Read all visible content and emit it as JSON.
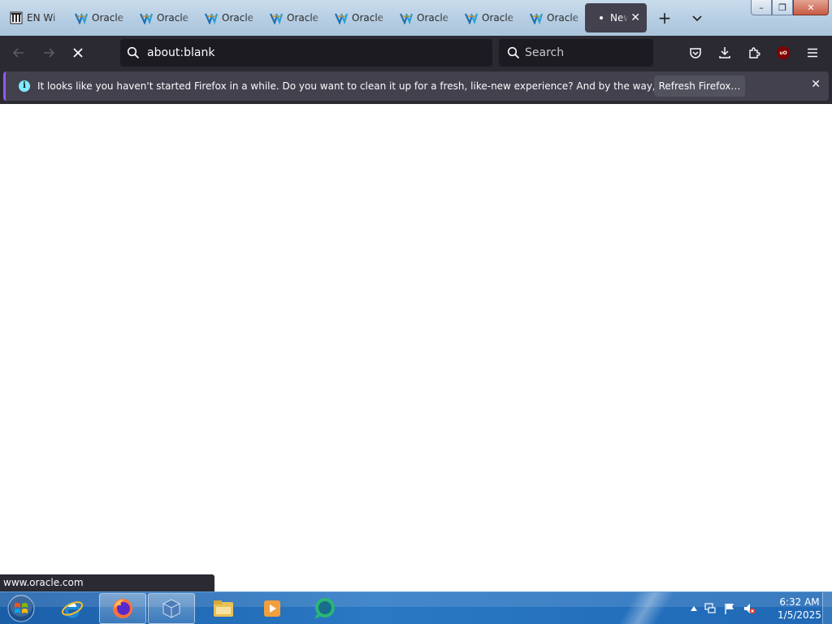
{
  "window": {
    "minimize_symbol": "–",
    "maximize_symbol": "❐",
    "close_symbol": "✕"
  },
  "tabs": [
    {
      "label": "EN Wi",
      "icon": "wikipedia-icon",
      "active": false
    },
    {
      "label": "Oracle",
      "icon": "oracle-icon",
      "active": false
    },
    {
      "label": "Oracle",
      "icon": "oracle-icon",
      "active": false
    },
    {
      "label": "Oracle",
      "icon": "oracle-icon",
      "active": false
    },
    {
      "label": "Oracle",
      "icon": "oracle-icon",
      "active": false
    },
    {
      "label": "Oracle",
      "icon": "oracle-icon",
      "active": false
    },
    {
      "label": "Oracle",
      "icon": "oracle-icon",
      "active": false
    },
    {
      "label": "Oracle",
      "icon": "oracle-icon",
      "active": false
    },
    {
      "label": "Oracle",
      "icon": "oracle-icon",
      "active": false
    },
    {
      "label": "New",
      "icon": "loading-dot-icon",
      "active": true,
      "close": "✕"
    }
  ],
  "tabstrip": {
    "new_tab": "+",
    "list_all_tabs": "⌄"
  },
  "navbar": {
    "url": "about:blank",
    "search_placeholder": "Search"
  },
  "notification": {
    "info_glyph": "i",
    "message": "It looks like you haven't started Firefox in a while. Do you want to clean it up for a fresh, like-new experience? And by the way, welcome back!",
    "button_label": "Refresh Firefox…",
    "close": "✕"
  },
  "status_link": "www.oracle.com",
  "taskbar": {
    "apps": [
      "internet-explorer",
      "firefox",
      "virtualbox",
      "file-explorer",
      "media-player",
      "chat-app"
    ],
    "ublock_label": "uO"
  },
  "clock": {
    "time": "6:32 AM",
    "date": "1/5/2025"
  },
  "colors": {
    "toolbar": "#2b2a33",
    "field": "#1c1b22",
    "notification": "#42414d",
    "accent": "#9059ff"
  }
}
